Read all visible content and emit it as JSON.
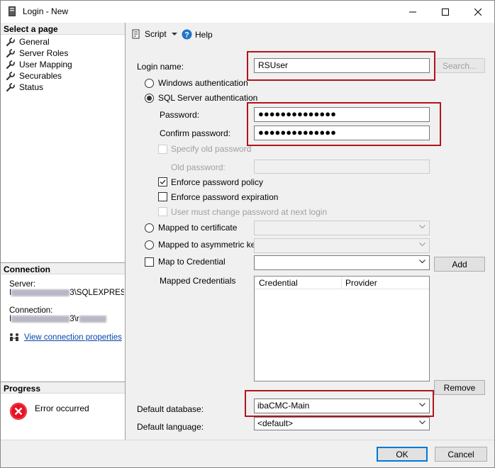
{
  "window": {
    "title": "Login - New",
    "minimize_icon": "minimize-icon",
    "maximize_icon": "maximize-icon",
    "close_icon": "close-icon"
  },
  "left": {
    "select_page_header": "Select a page",
    "pages": [
      {
        "label": "General",
        "icon": "wrench-icon"
      },
      {
        "label": "Server Roles",
        "icon": "wrench-icon"
      },
      {
        "label": "User Mapping",
        "icon": "wrench-icon"
      },
      {
        "label": "Securables",
        "icon": "wrench-icon"
      },
      {
        "label": "Status",
        "icon": "wrench-icon"
      }
    ],
    "connection_header": "Connection",
    "server_label": "Server:",
    "server_value_prefix": "I",
    "server_value_suffix": "3\\SQLEXPRES",
    "connection_label": "Connection:",
    "connection_value_prefix": "I",
    "connection_value_suffix": "3\\r",
    "view_connection_link": "View connection properties",
    "progress_header": "Progress",
    "progress_status": "Error occurred"
  },
  "toolbar": {
    "script_label": "Script",
    "help_label": "Help"
  },
  "form": {
    "login_name_label": "Login name:",
    "login_name_value": "RSUser",
    "search_button": "Search...",
    "windows_auth_label": "Windows authentication",
    "sql_auth_label": "SQL Server authentication",
    "password_label": "Password:",
    "password_value": "●●●●●●●●●●●●●●",
    "confirm_password_label": "Confirm password:",
    "confirm_password_value": "●●●●●●●●●●●●●●",
    "specify_old_password_label": "Specify old password",
    "old_password_label": "Old password:",
    "enforce_policy_label": "Enforce password policy",
    "enforce_expiration_label": "Enforce password expiration",
    "must_change_label": "User must change password at next login",
    "mapped_certificate_label": "Mapped to certificate",
    "mapped_asymmetric_label": "Mapped to asymmetric key",
    "map_credential_label": "Map to Credential",
    "add_button": "Add",
    "mapped_credentials_label": "Mapped Credentials",
    "credential_col": "Credential",
    "provider_col": "Provider",
    "remove_button": "Remove",
    "default_database_label": "Default database:",
    "default_database_value": "ibaCMC-Main",
    "default_language_label": "Default language:",
    "default_language_value": "<default>"
  },
  "buttons": {
    "ok": "OK",
    "cancel": "Cancel"
  },
  "colors": {
    "highlight_box": "#b0151b",
    "link": "#0645ad",
    "error_icon": "#e81123"
  }
}
